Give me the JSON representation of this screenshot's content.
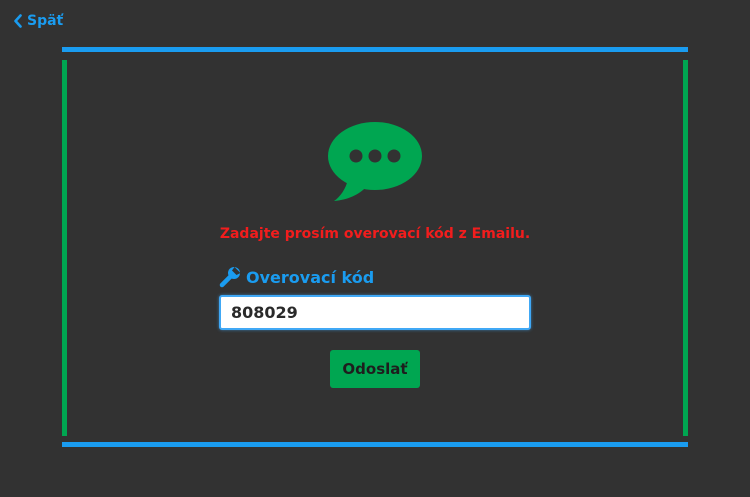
{
  "nav": {
    "back_label": "Späť",
    "back_icon": "chevron-left-icon"
  },
  "colors": {
    "background": "#323232",
    "accent_blue": "#1a9cf0",
    "accent_green": "#00a651",
    "error_red": "#f21d1d"
  },
  "content": {
    "icon": "chat-bubble-ellipsis-icon",
    "message": "Zadajte prosím overovací kód z Emailu.",
    "field": {
      "icon": "wrench-icon",
      "label": "Overovací kód",
      "value": "808029"
    },
    "submit_label": "Odoslať"
  }
}
